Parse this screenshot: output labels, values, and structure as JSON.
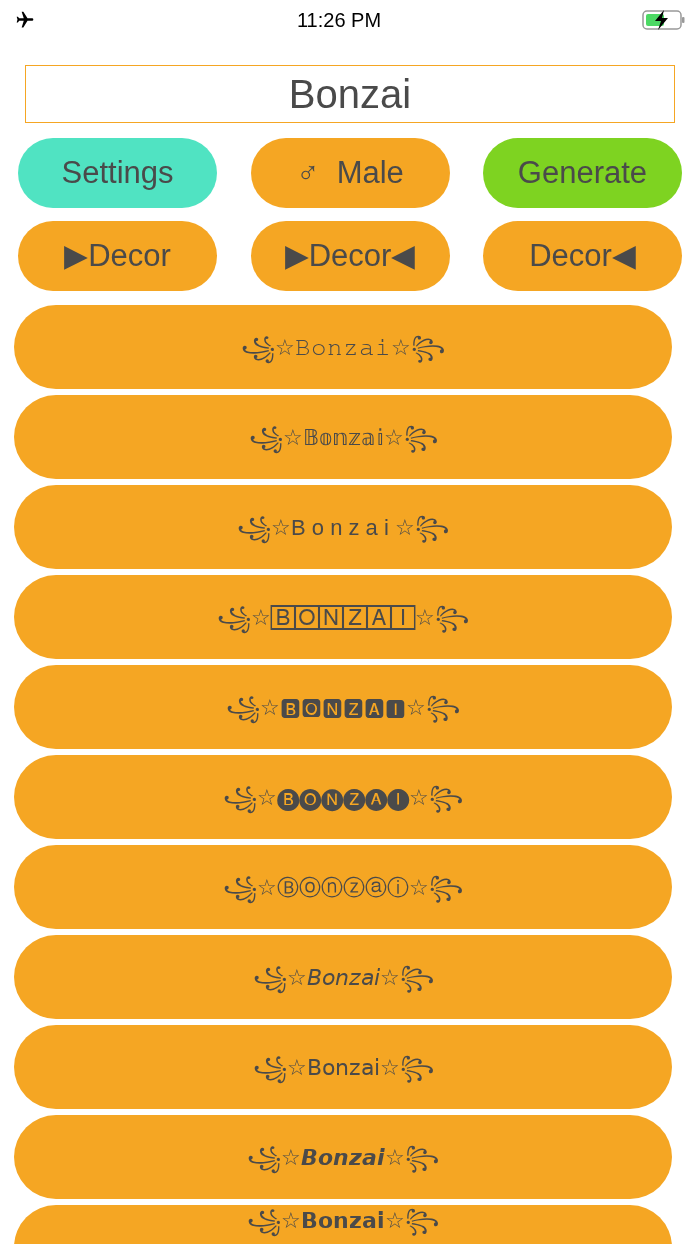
{
  "status_bar": {
    "time": "11:26 PM"
  },
  "name_field": {
    "value": "Bonzai"
  },
  "action_buttons": [
    {
      "label": "Settings",
      "color": "#50e3c2"
    },
    {
      "label": "♂  Male",
      "color": "#f5a623"
    },
    {
      "label": "Generate",
      "color": "#7ed321"
    }
  ],
  "decor_buttons": [
    {
      "label": "▶Decor"
    },
    {
      "label": "▶Decor◀"
    },
    {
      "label": "Decor◀"
    }
  ],
  "results": [
    "꧁☆𝙱𝚘𝚗𝚣𝚊𝚒☆꧂",
    "꧁☆𝔹𝕠𝕟𝕫𝕒𝕚☆꧂",
    "꧁☆B o n z a i ☆꧂",
    "꧁☆🄱🄾🄽🅉🄰🄸☆꧂",
    "꧁☆🅱🅾🅽🆉🅰🅸☆꧂",
    "꧁☆🅑🅞🅝🅩🅐🅘☆꧂",
    "꧁☆Ⓑⓞⓝⓩⓐⓘ☆꧂",
    "꧁☆𝘉𝘰𝘯𝘻𝘢𝘪☆꧂",
    "꧁☆𝖡𝗈𝗇𝗓𝖺𝗂☆꧂",
    "꧁☆𝘽𝙤𝙣𝙯𝙖𝙞☆꧂",
    "꧁☆𝗕𝗼𝗻𝘇𝗮𝗶☆꧂"
  ]
}
